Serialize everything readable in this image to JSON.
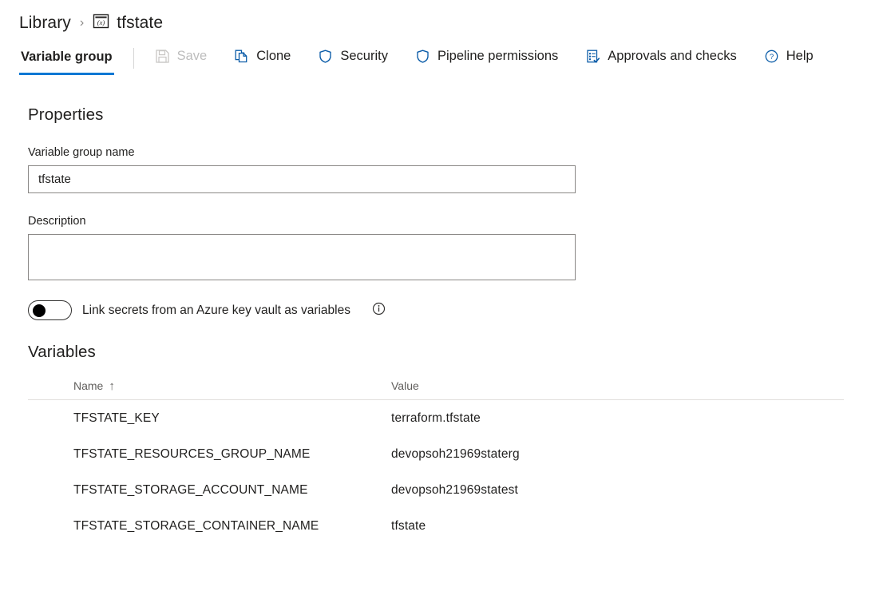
{
  "breadcrumb": {
    "root_label": "Library",
    "separator": "›",
    "icon_name": "variable-group-icon",
    "current_label": "tfstate"
  },
  "toolbar": {
    "tab_label": "Variable group",
    "items": [
      {
        "label": "Save",
        "icon": "save-icon",
        "disabled": true
      },
      {
        "label": "Clone",
        "icon": "clone-icon",
        "disabled": false
      },
      {
        "label": "Security",
        "icon": "shield-icon",
        "disabled": false
      },
      {
        "label": "Pipeline permissions",
        "icon": "shield-icon",
        "disabled": false
      },
      {
        "label": "Approvals and checks",
        "icon": "approvals-checklist-icon",
        "disabled": false
      },
      {
        "label": "Help",
        "icon": "help-circle-icon",
        "disabled": false
      }
    ]
  },
  "properties": {
    "section_title": "Properties",
    "name_label": "Variable group name",
    "name_value": "tfstate",
    "name_placeholder": "",
    "description_label": "Description",
    "description_value": "",
    "description_placeholder": "",
    "keyvault_toggle_label": "Link secrets from an Azure key vault as variables",
    "keyvault_toggle_state": "off",
    "info_icon": "info-icon"
  },
  "variables": {
    "section_title": "Variables",
    "columns": [
      "Name",
      "Value"
    ],
    "sort_column": "Name",
    "sort_arrow": "↑",
    "rows": [
      {
        "name": "TFSTATE_KEY",
        "value": "terraform.tfstate"
      },
      {
        "name": "TFSTATE_RESOURCES_GROUP_NAME",
        "value": "devopsoh21969staterg"
      },
      {
        "name": "TFSTATE_STORAGE_ACCOUNT_NAME",
        "value": "devopsoh21969statest"
      },
      {
        "name": "TFSTATE_STORAGE_CONTAINER_NAME",
        "value": "tfstate"
      }
    ]
  },
  "colors": {
    "accent": "#0078d4",
    "text": "#201f1e",
    "muted": "#605e5c",
    "disabled": "#bdbdbd",
    "border": "#8a8886",
    "divider": "#e1dfdd"
  }
}
